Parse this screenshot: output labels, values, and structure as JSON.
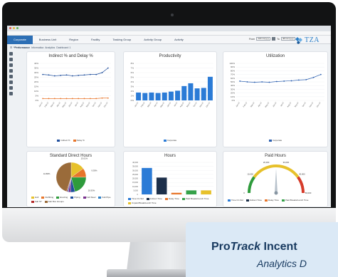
{
  "colors": {
    "accent": "#2d6fb5",
    "brand": "#2c7fc7",
    "indirect_line": "#1f4e9c",
    "delay_line": "#e8752a",
    "bar_blue": "#2b7bd6",
    "util_line": "#2b5fb0",
    "banner_bg": "#dbe9f6"
  },
  "nav": {
    "tabs": [
      "Corporate",
      "Business Unit",
      "Region",
      "Facility",
      "Tasking Group",
      "Activity Group",
      "Activity"
    ],
    "active_tab": 0
  },
  "filters": {
    "from_label": "From",
    "from_value": "dd/mm/yyyy",
    "to_label": "To",
    "to_value": "dd/mm/yyyy"
  },
  "logo": {
    "text": "TZA"
  },
  "breadcrumb": {
    "home": "☰",
    "current": "*Performance",
    "items": [
      "Informatica",
      "Analytics",
      "Dashboard 1"
    ]
  },
  "rail_icons": [
    "chart-icon",
    "grid-icon",
    "clock-icon",
    "people-icon",
    "filter-icon",
    "layers-icon",
    "print-icon",
    "settings-icon"
  ],
  "panels": {
    "indirect_delay": {
      "title": "Indirect % and  Delay %",
      "legend": [
        "Indirect %",
        "Delay %"
      ]
    },
    "productivity": {
      "title": "Productivity",
      "legend": [
        "Corporate"
      ]
    },
    "utilization": {
      "title": "Utilization",
      "legend": [
        "Corporate"
      ]
    },
    "standard_direct_hours": {
      "title": "Standard Direct Hours",
      "slice_labels": [
        "15.01%",
        "9.93%",
        "20.93%",
        "4.60%",
        "2.50%",
        "1.08%",
        "1.00%",
        "44.88%"
      ],
      "legend": [
        "Hull",
        "Outfitting",
        "Erecting",
        "Piping",
        "Fab Steel",
        "Fab Pipe",
        "Fab ST",
        "Fab Box Groups"
      ]
    },
    "hours": {
      "title": "Hours",
      "legend": [
        "Time On Std",
        "Indirect Time",
        "Delay Time",
        "Paid Breaks/Lunch Time",
        "Unpaid Break/Lunch Time"
      ]
    },
    "paid_hours": {
      "title": "Paid Hours",
      "gauge_labels": [
        "0",
        "10,000",
        "20,000",
        "30,000",
        "40,000",
        "50,000"
      ],
      "legend": [
        "Time On Std",
        "Indirect Time",
        "Delay Time",
        "Paid Breaks/Lunch Time"
      ]
    }
  },
  "chart_data": [
    {
      "type": "line",
      "title": "Indirect % and  Delay %",
      "categories": [
        "Jan-17",
        "Feb-17",
        "Mar-17",
        "Apr-17",
        "May-17",
        "Jun-17",
        "Jul-17",
        "Aug-17",
        "Sep-17",
        "Oct-17",
        "Nov-17",
        "Dec-17"
      ],
      "ylim": [
        0,
        40
      ],
      "yticks": [
        "0%",
        "5%",
        "10%",
        "15%",
        "20%",
        "25%",
        "30%",
        "35%",
        "40%"
      ],
      "series": [
        {
          "name": "Indirect %",
          "values": [
            28,
            27.5,
            26.5,
            27,
            27.5,
            26.5,
            27,
            27.5,
            28,
            28,
            30,
            35
          ]
        },
        {
          "name": "Delay %",
          "values": [
            2,
            2,
            2,
            2,
            2,
            2,
            2,
            2,
            2,
            2,
            2.5,
            2.5
          ]
        }
      ]
    },
    {
      "type": "bar",
      "title": "Productivity",
      "categories": [
        "Jan-17",
        "Feb-17",
        "Mar-17",
        "Apr-17",
        "May-17",
        "Jun-17",
        "Jul-17",
        "Aug-17",
        "Sep-17",
        "Oct-17",
        "Nov-17",
        "Dec-17"
      ],
      "ylim": [
        0,
        8
      ],
      "yticks": [
        "0%",
        "1%",
        "2%",
        "3%",
        "4%",
        "5%",
        "6%",
        "7%",
        "8%"
      ],
      "series": [
        {
          "name": "Corporate",
          "values": [
            1.7,
            1.6,
            1.7,
            1.6,
            1.7,
            1.9,
            2.1,
            3.1,
            3.7,
            2.6,
            2.7,
            5.1
          ]
        }
      ]
    },
    {
      "type": "line",
      "title": "Utilization",
      "categories": [
        "Jan-17",
        "Feb-17",
        "Mar-17",
        "Apr-17",
        "May-17",
        "Jun-17",
        "Jul-17",
        "Aug-17",
        "Sep-17",
        "Oct-17",
        "Nov-17",
        "Dec-17"
      ],
      "ylim": [
        0,
        100
      ],
      "yticks": [
        "0%",
        "10%",
        "20%",
        "30%",
        "40%",
        "50%",
        "60%",
        "70%",
        "80%",
        "90%",
        "100%"
      ],
      "series": [
        {
          "name": "Corporate",
          "values": [
            52,
            50,
            49,
            50,
            49,
            51,
            52,
            53,
            55,
            56,
            62,
            70
          ]
        }
      ]
    },
    {
      "type": "pie",
      "title": "Standard Direct Hours",
      "labels": [
        "Hull",
        "Outfitting",
        "Erecting",
        "Piping",
        "Fab Steel",
        "Fab Pipe",
        "Fab ST",
        "Fab Box Groups"
      ],
      "values": [
        15.01,
        9.93,
        20.93,
        4.6,
        2.5,
        1.08,
        1.0,
        44.88
      ],
      "colors": [
        "#e7c12b",
        "#e8752a",
        "#2e9b3c",
        "#1f4e9c",
        "#7a2f8f",
        "#2c7fc7",
        "#b52b2b",
        "#9a6b3a"
      ]
    },
    {
      "type": "bar",
      "title": "Hours",
      "categories": [
        "Time On Std",
        "Indirect Time",
        "Delay Time",
        "Paid Breaks/Lunch Time",
        "Unpaid Break/Lunch Time"
      ],
      "ylim": [
        0,
        40000
      ],
      "yticks": [
        "0",
        "5,000",
        "10,000",
        "15,000",
        "20,000",
        "25,000",
        "30,000",
        "35,000",
        "40,000"
      ],
      "values": [
        33000,
        21000,
        2000,
        5000,
        5000
      ],
      "colors": [
        "#2b7bd6",
        "#1c2f4a",
        "#e8752a",
        "#36a24a",
        "#e7c12b"
      ]
    },
    {
      "type": "gauge",
      "title": "Paid Hours",
      "min": 0,
      "max": 50000,
      "value": 25000,
      "bands": [
        {
          "from": 0,
          "to": 10000,
          "color": "#2e9b3c"
        },
        {
          "from": 10000,
          "to": 40000,
          "color": "#e7c12b"
        },
        {
          "from": 40000,
          "to": 50000,
          "color": "#d63b2a"
        }
      ]
    }
  ],
  "banner": {
    "title_prefix": "Pro",
    "title_em": "Track",
    "title_suffix": " Incent",
    "subtitle": "Analytics D"
  }
}
